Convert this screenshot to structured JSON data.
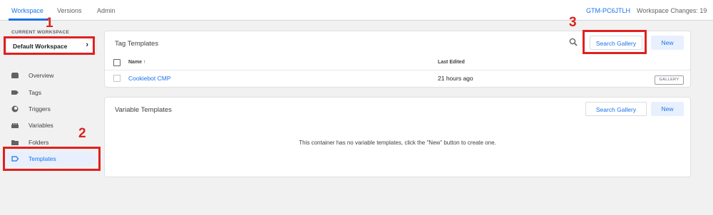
{
  "topnav": {
    "tabs": [
      {
        "label": "Workspace"
      },
      {
        "label": "Versions"
      },
      {
        "label": "Admin"
      }
    ],
    "container_id": "GTM-PC6JTLH",
    "workspace_changes": "Workspace Changes: 19"
  },
  "sidebar": {
    "section_label": "CURRENT WORKSPACE",
    "workspace_name": "Default Workspace",
    "items": [
      {
        "label": "Overview",
        "icon": "overview-icon"
      },
      {
        "label": "Tags",
        "icon": "tag-icon"
      },
      {
        "label": "Triggers",
        "icon": "trigger-icon"
      },
      {
        "label": "Variables",
        "icon": "variables-icon"
      },
      {
        "label": "Folders",
        "icon": "folder-icon"
      },
      {
        "label": "Templates",
        "icon": "templates-icon",
        "active": true
      }
    ]
  },
  "annotations": [
    "1",
    "2",
    "3"
  ],
  "tag_templates": {
    "title": "Tag Templates",
    "search_gallery_label": "Search Gallery",
    "new_label": "New",
    "columns": {
      "name": "Name ↑",
      "last_edited": "Last Edited"
    },
    "rows": [
      {
        "name": "Cookiebot CMP",
        "last_edited": "21 hours ago",
        "badge": "GALLERY"
      }
    ]
  },
  "variable_templates": {
    "title": "Variable Templates",
    "search_gallery_label": "Search Gallery",
    "new_label": "New",
    "empty_message": "This container has no variable templates, click the \"New\" button to create one."
  },
  "colors": {
    "accent": "#1a73e8",
    "annotation": "#e02020"
  }
}
